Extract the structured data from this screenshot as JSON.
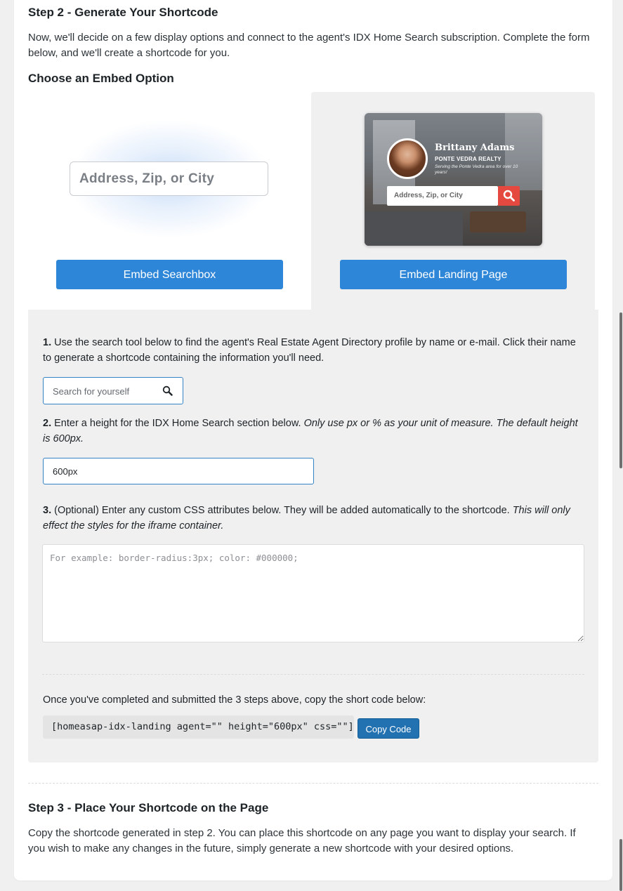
{
  "step2": {
    "title": "Step 2 - Generate Your Shortcode",
    "intro": "Now, we'll decide on a few display options and connect to the agent's IDX Home Search subscription. Complete the form below, and we'll create a shortcode for you."
  },
  "embed": {
    "heading": "Choose an Embed Option",
    "searchbox_preview_placeholder": "Address, Zip, or City",
    "landing_preview": {
      "agent_name": "Brittany Adams",
      "company": "PONTE VEDRA REALTY",
      "tagline": "Serving the Ponte Vedra area for over 10 years!",
      "search_placeholder": "Address, Zip, or City"
    },
    "searchbox_button": "Embed Searchbox",
    "landing_button": "Embed Landing Page"
  },
  "form": {
    "step1_num": "1.",
    "step1_text": "Use the search tool below to find the agent's Real Estate Agent Directory profile by name or e-mail. Click their name to generate a shortcode containing the information you'll need.",
    "search_placeholder": "Search for yourself",
    "step2_num": "2.",
    "step2_text": "Enter a height for the IDX Home Search section below.",
    "step2_note": "Only use px or % as your unit of measure. The default height is 600px.",
    "height_value": "600px",
    "step3_num": "3.",
    "step3_text": "(Optional) Enter any custom CSS attributes below. They will be added automatically to the shortcode.",
    "step3_note": "This will only effect the styles for the iframe container.",
    "css_placeholder": "For example: border-radius:3px; color: #000000;",
    "copy_instruction": "Once you've completed and submitted the 3 steps above, copy the short code below:",
    "shortcode": "[homeasap-idx-landing agent=\"\" height=\"600px\" css=\"\"]",
    "copy_button": "Copy Code"
  },
  "step3": {
    "title": "Step 3 - Place Your Shortcode on the Page",
    "body": "Copy the shortcode generated in step 2. You can place this shortcode on any page you want to display your search. If you wish to make any changes in the future, simply generate a new shortcode with your desired options."
  },
  "colors": {
    "primary_button": "#2e86d8",
    "copy_button": "#2271b1",
    "panel_bg": "#f0f0f1",
    "search_button_red": "#e4483e"
  }
}
